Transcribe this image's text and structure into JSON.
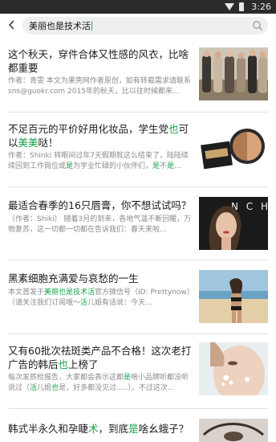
{
  "status_bar": {
    "time": "3:26"
  },
  "search": {
    "query": "美丽也是技术活"
  },
  "articles": [
    {
      "title_parts": [
        "这个秋天，穿件合体又性感的风衣，比啥都重要"
      ],
      "desc_parts": [
        "作者：青雯 本文为果壳网作者原创，如有转载需求请联系 sns@guokr.com 2015年的秋天，比以往时候都来..."
      ],
      "thumb_icon": "fashion-models-photo"
    },
    {
      "title_parts": [
        "不足百元的平价好用化妆品，学生党",
        "也",
        "可以",
        "美美",
        "哒！"
      ],
      "desc_parts": [
        "作者：Shinki 转眼间过年7天假期就这么结束了，陆陆续续回到工作岗位或",
        "是",
        "为学业忙碌的小伙伴们，",
        "是",
        "不",
        "是",
        "..."
      ],
      "thumb_icon": "cosmetics-palette-photo"
    },
    {
      "title_parts": [
        "最适合春季的16只唇膏，你不想试试吗？"
      ],
      "desc_parts": [
        "（作者：Shiki） 随着3月的到来，各地气温不断回暖，万物复苏，这一切都一切都在告诉我们：春天来啦..."
      ],
      "thumb_icon": "woman-portrait-photo",
      "thumb_text": "N C H"
    },
    {
      "title_parts": [
        "黑素细胞充满爱与哀愁的一生"
      ],
      "desc_parts": [
        "本文首发于",
        "美丽也是技术活",
        "官方微信号（ID: Prettynow）（请关注我们订阅哦～",
        "活",
        "儿姐有话说：今天..."
      ],
      "thumb_icon": "beach-woman-photo"
    },
    {
      "title_parts": [
        "又有60批次祛斑类产品不合格！这次老打广告的韩后",
        "也",
        "上榜了"
      ],
      "desc_parts": [
        "每次发质检报告，大家都会表示这都",
        "是",
        "啥小品牌听都没听说过（",
        "活",
        "儿姐",
        "也",
        "是，好多都没见过.....）。不过这次..."
      ],
      "thumb_icon": "face-mask-photo"
    },
    {
      "title_parts": [
        "韩式半永久和孕睫",
        "术",
        "，到底",
        "是",
        "啥幺蛾子？"
      ],
      "desc_parts": [
        ""
      ],
      "thumb_icon": "eye-lashes-photo"
    }
  ]
}
